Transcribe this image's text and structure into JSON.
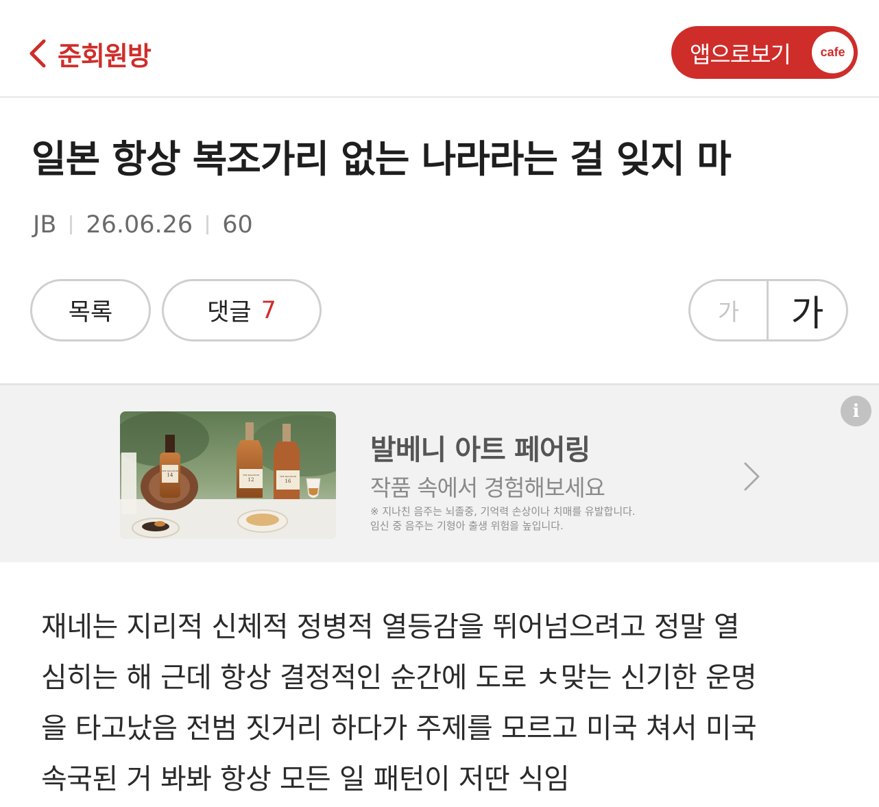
{
  "header": {
    "back_label": "준회원방",
    "app_button_label": "앱으로보기",
    "app_badge_text": "cafe",
    "accent_color": "#cf2d2a"
  },
  "post": {
    "title": "일본 항상 복조가리 없는 나라라는 걸 잊지 마",
    "author": "JB",
    "date": "26.06.26",
    "views": "60"
  },
  "actions": {
    "list_label": "목록",
    "comments_label": "댓글",
    "comments_count": "7",
    "font_small_label": "가",
    "font_large_label": "가"
  },
  "ad": {
    "title": "발베니 아트 페어링",
    "subtitle": "작품 속에서 경험해보세요",
    "warning_line1": "※ 지나친 음주는 뇌졸중, 기억력 손상이나 치매를 유발합니다.",
    "warning_line2": "임신 중 음주는 기형아 출생 위험을 높입니다.",
    "info_icon_text": "i",
    "image_icon": "whisky-bottles-image",
    "bottle_labels": [
      "THE BALVENIE",
      "THE BALVENIE",
      "THE BALVENIE"
    ],
    "bottle_ages": [
      "14",
      "12",
      "16"
    ]
  },
  "body": {
    "lines": [
      "재네는 지리적 신체적 정병적 열등감을 뛰어넘으려고 정말 열",
      "심히는 해 근데 항상 결정적인 순간에 도로 ㅊ맞는 신기한 운명",
      "을 타고났음 전범 짓거리 하다가 주제를 모르고 미국 쳐서 미국",
      "속국된 거 봐봐 항상 모든 일 패턴이 저딴 식임"
    ]
  }
}
